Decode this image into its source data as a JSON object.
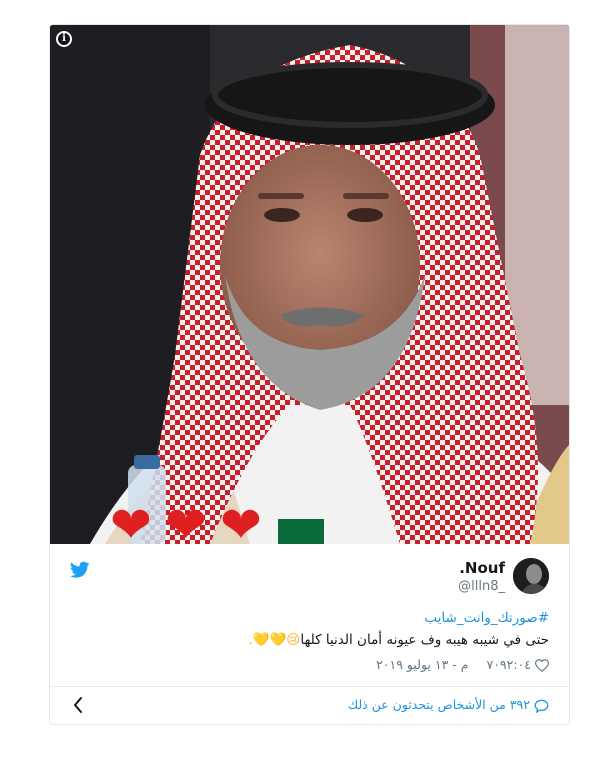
{
  "tweet": {
    "author_name": "Nouf.",
    "author_handle": "@llln8_",
    "hashtag": "#صورتك_وانت_شايب",
    "text": "حتى في شيبه هيبه وف عيونه أمان الدنيا كلها",
    "emojis": "😢💛💛.",
    "like_count": "٧٠٩",
    "timestamp": "٢:٠٤ م - ١٣ يوليو ٢٠١٩",
    "conversation": "٣٩٢ من الأشخاص يتحدثون عن ذلك"
  },
  "media": {
    "info_glyph": "i",
    "hearts": [
      "❤",
      "❤",
      "❤"
    ],
    "icons": [
      "info-icon",
      "heart-emoji"
    ]
  },
  "icons": {
    "brand": "twitter-bird-icon",
    "like": "heart-outline-icon",
    "reply": "speech-bubble-icon",
    "back": "chevron-left-icon"
  },
  "colors": {
    "brand": "#1da1f2",
    "link": "#1b95e0",
    "muted": "#657786",
    "border": "#e1e8ed",
    "heart_emoji": "#e02020"
  }
}
